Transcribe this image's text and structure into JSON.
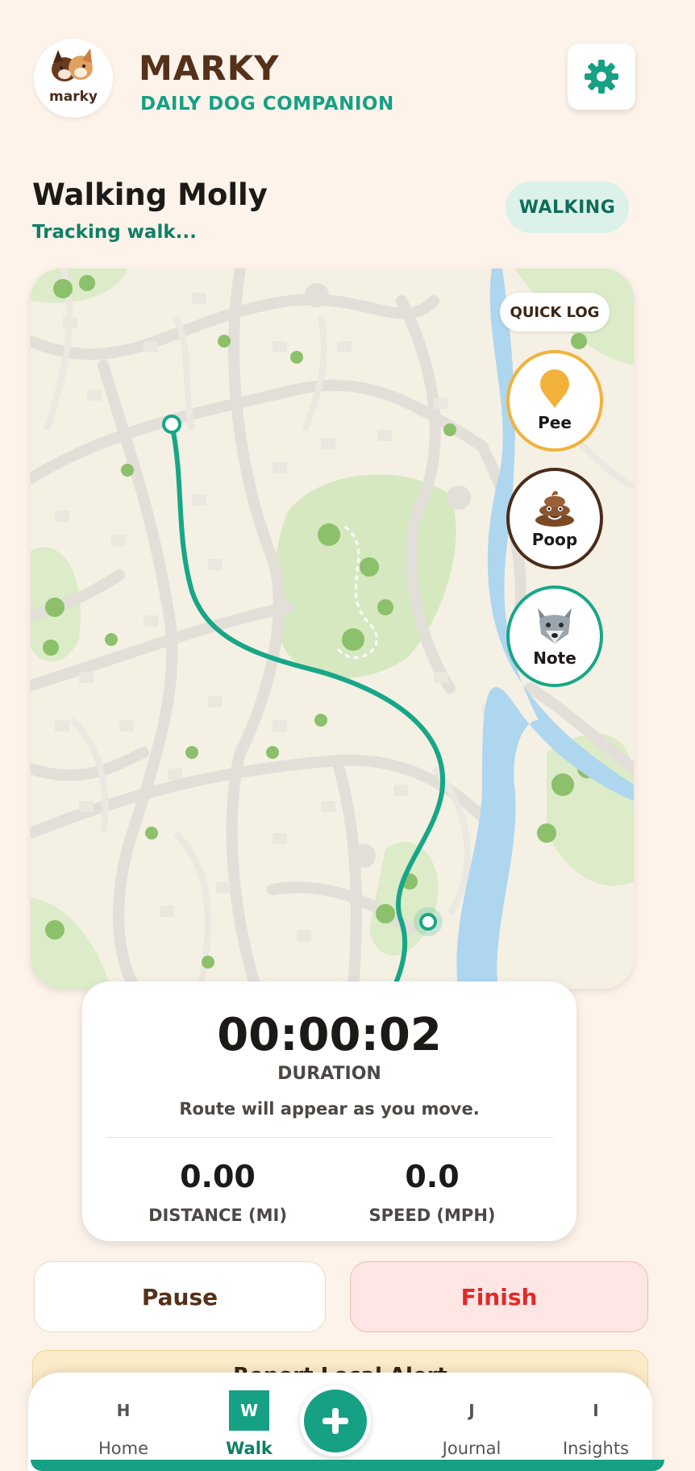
{
  "header": {
    "logo_text": "marky",
    "app_name": "MARKY",
    "subtitle": "DAILY DOG COMPANION",
    "settings_icon": "gear-icon",
    "accent": "#16a084"
  },
  "walk": {
    "title": "Walking Molly",
    "status": "Tracking walk...",
    "badge": "WALKING"
  },
  "map": {
    "quick_log_label": "QUICK LOG",
    "quick_log": [
      {
        "label": "Pee",
        "icon": "pin-icon",
        "color": "#f2b23a"
      },
      {
        "label": "Poop",
        "icon": "poop-icon",
        "color": "#4a2c1a"
      },
      {
        "label": "Note",
        "icon": "wolf-icon",
        "color": "#17a787"
      }
    ],
    "route_color": "#17a787"
  },
  "stats": {
    "duration": "00:00:02",
    "duration_label": "DURATION",
    "route_message": "Route will appear as you move.",
    "distance": "0.00",
    "distance_label": "DISTANCE (MI)",
    "speed": "0.0",
    "speed_label": "SPEED (MPH)"
  },
  "actions": {
    "pause": "Pause",
    "finish": "Finish",
    "alert": "Report Local Alert"
  },
  "nav": {
    "items": [
      {
        "letter": "H",
        "label": "Home"
      },
      {
        "letter": "W",
        "label": "Walk"
      },
      {
        "letter": "J",
        "label": "Journal"
      },
      {
        "letter": "I",
        "label": "Insights"
      }
    ],
    "active": "Walk",
    "fab_icon": "plus-icon"
  }
}
